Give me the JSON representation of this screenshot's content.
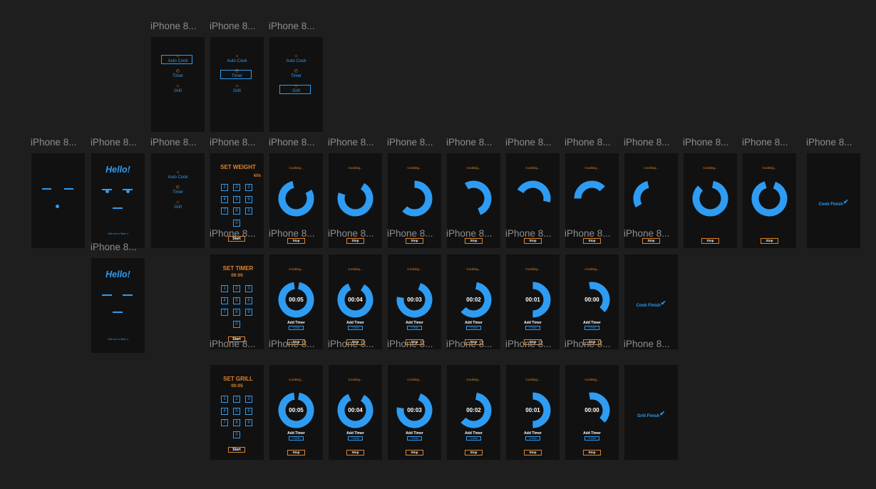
{
  "frame_label": "iPhone 8...",
  "menu": {
    "auto_cook": "Auto Cook",
    "timer": "Timer",
    "grill": "Grill",
    "icons": [
      "sun-icon",
      "clock-icon",
      "flame-icon"
    ]
  },
  "splash": {
    "hello": "Hello!",
    "start_hint": "Click me to Start ➔"
  },
  "keypad": [
    "1",
    "2",
    "3",
    "4",
    "5",
    "6",
    "7",
    "8",
    "9",
    "0"
  ],
  "weight": {
    "title": "SET WEIGHT",
    "unit": "kl/s",
    "start": "Start"
  },
  "timer": {
    "title": "SET TIMER",
    "value": "00:05",
    "start": "Start"
  },
  "grill": {
    "title": "SET GRILL",
    "value": "00:05",
    "start": "Start"
  },
  "cooking": {
    "status": "Cooking...",
    "stop": "Stop",
    "add_timer": "Add Timer",
    "plus": "+10min",
    "countdown": [
      "00:05",
      "00:04",
      "00:03",
      "00:02",
      "00:01",
      "00:00"
    ],
    "weight_progress": [
      0.8,
      0.72,
      0.62,
      0.52,
      0.45,
      0.38,
      0.3,
      0.85,
      0.9
    ]
  },
  "finish": {
    "cook": "Cook Finish",
    "grill": "Grill Finish"
  },
  "colors": {
    "background": "#1e1e1e",
    "frame": "#111111",
    "accent_blue": "#2e9cf3",
    "accent_orange": "#e0842a"
  }
}
